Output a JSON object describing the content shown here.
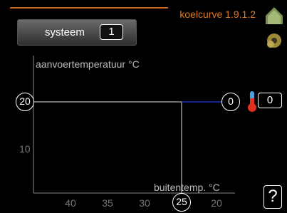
{
  "menu": {
    "title": "koelcurve 1.9.1.2"
  },
  "system_selector": {
    "label": "systeem",
    "value": "1"
  },
  "graph": {
    "y_axis_label": "aanvoertemperatuur °C",
    "x_axis_label": "buitentemp. °C",
    "y_ticks": [
      "20",
      "10"
    ],
    "x_ticks": [
      "40",
      "35",
      "30",
      "25",
      "20"
    ],
    "selected_y": "20",
    "selected_x": "25",
    "curve_end_value": "0",
    "curve_color": "#1a2ec8"
  },
  "offset": {
    "value": "0"
  },
  "help": {
    "label": "?"
  },
  "colors": {
    "accent": "#e0781e",
    "axis": "#888888"
  },
  "icons": [
    "house-icon",
    "settings-gear-icon",
    "thermometer-icon"
  ]
}
